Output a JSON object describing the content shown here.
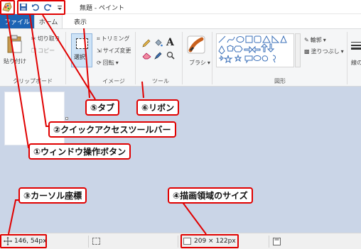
{
  "window": {
    "title": "無題 - ペイント"
  },
  "tabs": {
    "file": "ファイル",
    "home": "ホーム",
    "view": "表示"
  },
  "clipboard": {
    "paste": "貼り付け",
    "cut": "切り取り",
    "copy": "コピー",
    "group_label": "クリップボード"
  },
  "image": {
    "select": "選択",
    "crop": "トリミング",
    "resize": "サイズ変更",
    "rotate": "回転",
    "group_label": "イメージ"
  },
  "tools": {
    "text_tool": "A",
    "group_label": "ツール"
  },
  "brushes": {
    "label": "ブラシ"
  },
  "shapes": {
    "outline": "輪郭",
    "fill": "塗りつぶし",
    "group_label": "図形"
  },
  "line_width": {
    "label": "線の"
  },
  "status": {
    "cursor_pos": "146, 54px",
    "canvas_size": "209 × 122px"
  },
  "annotations": {
    "window_buttons": "①ウィンドウ操作ボタン",
    "quick_access": "②クイックアクセスツールバー",
    "cursor_coord": "③カーソル座標",
    "canvas_size": "④描画領域のサイズ",
    "tab": "⑤タブ",
    "ribbon": "⑥リボン"
  },
  "colors": {
    "accent": "#1c64b4",
    "annotation": "#e00000",
    "canvas_bg": "#cad5e7"
  }
}
